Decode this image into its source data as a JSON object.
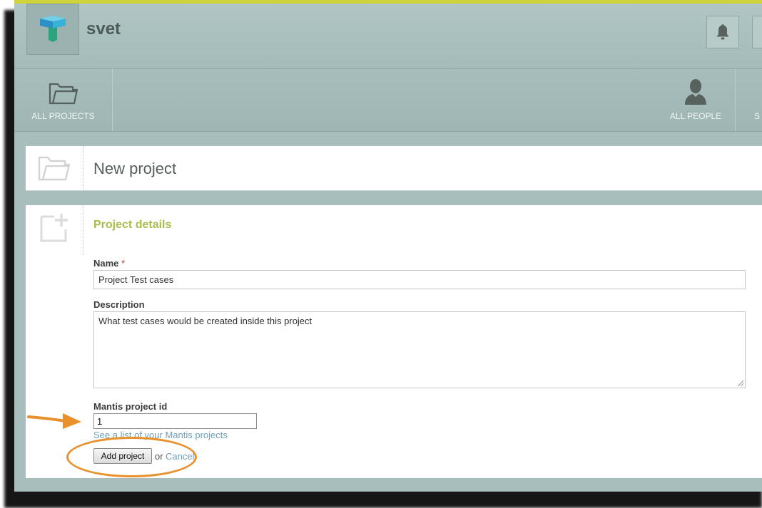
{
  "header": {
    "app_name": "svet",
    "logo_icon": "teal-cube-logo-icon",
    "notification_icon": "bell-icon"
  },
  "nav": {
    "items": [
      {
        "label": "ALL PROJECTS",
        "icon": "folder-icon"
      },
      {
        "label": "ALL PEOPLE",
        "icon": "person-icon"
      },
      {
        "label": "S",
        "icon": ""
      }
    ]
  },
  "page": {
    "title": "New project",
    "title_icon": "folder-outline-icon"
  },
  "form": {
    "section_title": "Project details",
    "section_icon": "new-item-icon",
    "name": {
      "label": "Name",
      "required_mark": "*",
      "value": "Project Test cases"
    },
    "description": {
      "label": "Description",
      "value": "What test cases would be created inside this project"
    },
    "mantis_id": {
      "label": "Mantis project id",
      "value": "1"
    },
    "mantis_link": "See a list of your Mantis projects",
    "submit_label": "Add project",
    "or_text": "or",
    "cancel_label": "Cancel"
  },
  "colors": {
    "accent_top": "#cfd43a",
    "section_title": "#a6bd4b",
    "link": "#6f9fb8",
    "annotation": "#e8912d"
  }
}
